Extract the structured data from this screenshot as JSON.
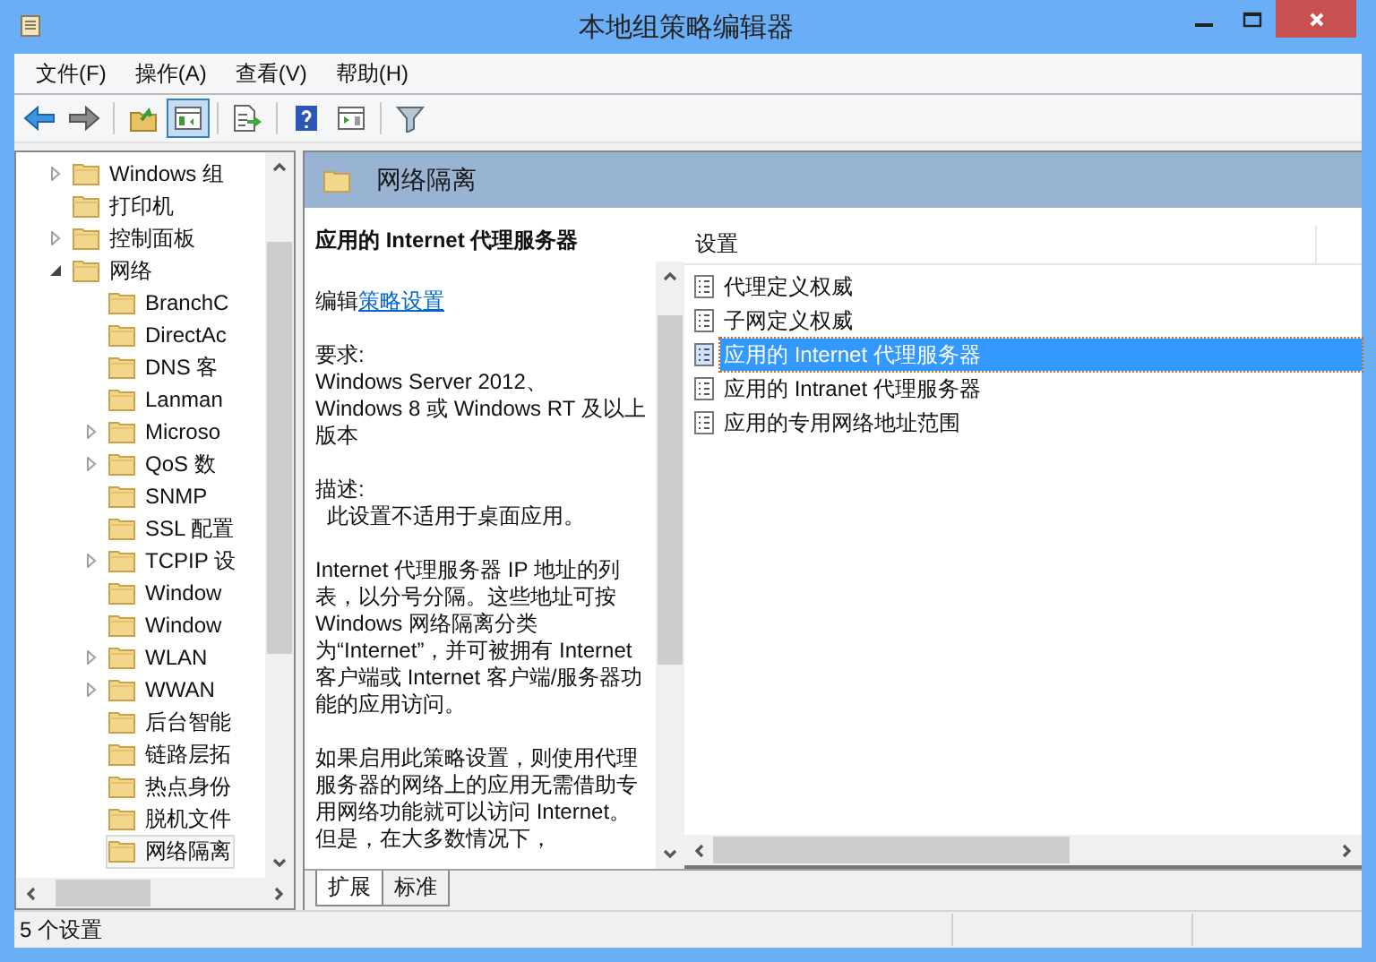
{
  "window": {
    "title": "本地组策略编辑器"
  },
  "menu": [
    "文件(F)",
    "操作(A)",
    "查看(V)",
    "帮助(H)"
  ],
  "toolbar": [
    [
      {
        "kind": "back",
        "pressed": false
      },
      {
        "kind": "forward",
        "pressed": false
      }
    ],
    [
      {
        "kind": "up",
        "pressed": false
      },
      {
        "kind": "tree",
        "pressed": true
      }
    ],
    [
      {
        "kind": "export",
        "pressed": false
      }
    ],
    [
      {
        "kind": "help",
        "pressed": false
      },
      {
        "kind": "pane",
        "pressed": false
      }
    ],
    [
      {
        "kind": "filter",
        "pressed": false
      }
    ]
  ],
  "tree": [
    {
      "label": "Windows 组",
      "kind": "branch",
      "expanded": false,
      "selected": false
    },
    {
      "label": "打印机",
      "kind": "leaf",
      "selected": false
    },
    {
      "label": "控制面板",
      "kind": "branch",
      "expanded": false,
      "selected": false
    },
    {
      "label": "网络",
      "kind": "branch",
      "expanded": true,
      "selected": false,
      "children": [
        {
          "label": "BranchC",
          "kind": "leaf",
          "selected": false
        },
        {
          "label": "DirectAc",
          "kind": "leaf",
          "selected": false
        },
        {
          "label": "DNS 客",
          "kind": "leaf",
          "selected": false
        },
        {
          "label": "Lanman",
          "kind": "leaf",
          "selected": false
        },
        {
          "label": "Microso",
          "kind": "branch",
          "expanded": false,
          "selected": false
        },
        {
          "label": "QoS 数",
          "kind": "branch",
          "expanded": false,
          "selected": false
        },
        {
          "label": "SNMP",
          "kind": "leaf",
          "selected": false
        },
        {
          "label": "SSL 配置",
          "kind": "leaf",
          "selected": false
        },
        {
          "label": "TCPIP 设",
          "kind": "branch",
          "expanded": false,
          "selected": false
        },
        {
          "label": "Window",
          "kind": "leaf",
          "selected": false
        },
        {
          "label": "Window",
          "kind": "leaf",
          "selected": false
        },
        {
          "label": "WLAN",
          "kind": "branch",
          "expanded": false,
          "selected": false
        },
        {
          "label": "WWAN",
          "kind": "branch",
          "expanded": false,
          "selected": false
        },
        {
          "label": "后台智能",
          "kind": "leaf",
          "selected": false
        },
        {
          "label": "链路层拓",
          "kind": "leaf",
          "selected": false
        },
        {
          "label": "热点身份",
          "kind": "leaf",
          "selected": false
        },
        {
          "label": "脱机文件",
          "kind": "leaf",
          "selected": false
        },
        {
          "label": "网络隔离",
          "kind": "leaf",
          "selected": true
        }
      ]
    }
  ],
  "header": {
    "title": "网络隔离"
  },
  "description": {
    "title": "应用的 Internet 代理服务器",
    "edit_label": "编辑",
    "edit_link": "策略设置",
    "paragraphs": [
      [
        "要求:",
        "Windows Server 2012、",
        "Windows 8 或 Windows RT 及以上版本"
      ],
      [
        "描述:",
        "  此设置不适用于桌面应用。"
      ],
      [
        "Internet 代理服务器 IP 地址的列表，以分号分隔。这些地址可按 Windows 网络隔离分类为“Internet”，并可被拥有 Internet 客户端或 Internet 客户端/服务器功能的应用访问。"
      ],
      [
        "如果启用此策略设置，则使用代理服务器的网络上的应用无需借助专用网络功能就可以访问 Internet。但是，在大多数情况下，"
      ]
    ]
  },
  "list": {
    "column": "设置",
    "rows": [
      {
        "name": "代理定义权威",
        "selected": false
      },
      {
        "name": "子网定义权威",
        "selected": false
      },
      {
        "name": "应用的 Internet 代理服务器",
        "selected": true
      },
      {
        "name": "应用的 Intranet 代理服务器",
        "selected": false
      },
      {
        "name": "应用的专用网络地址范围",
        "selected": false
      }
    ]
  },
  "tabs": [
    {
      "label": "扩展",
      "selected": true
    },
    {
      "label": "标准",
      "selected": false
    }
  ],
  "status_bar": "5 个设置"
}
